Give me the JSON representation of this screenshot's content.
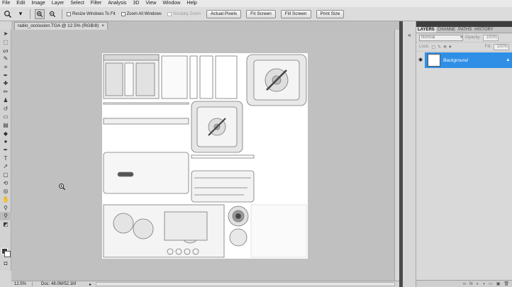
{
  "menubar": {
    "items": [
      "File",
      "Edit",
      "Image",
      "Layer",
      "Select",
      "Filter",
      "Analysis",
      "3D",
      "View",
      "Window",
      "Help"
    ]
  },
  "options": {
    "resize_windows": "Resize Windows To Fit",
    "zoom_all_windows": "Zoom All Windows",
    "scrubby_zoom": "Scrubby Zoom",
    "actual_pixels": "Actual Pixels",
    "fit_screen": "Fit Screen",
    "fill_screen": "Fill Screen",
    "print_size": "Print Size"
  },
  "document": {
    "tab_title": "radio_occlusion.TGA @ 12.5% (RGB/8)",
    "close_glyph": "×"
  },
  "status": {
    "zoom": "12.5%",
    "doc_size": "Doc: 48.0M/52.1M"
  },
  "layers_panel": {
    "tabs": [
      "LAYERS",
      "CHANNE",
      "PATHS",
      "HISTORY"
    ],
    "blend_mode": "Normal",
    "opacity_label": "Opacity:",
    "opacity_value": "100%",
    "lock_label": "Lock:",
    "fill_label": "Fill:",
    "fill_value": "100%",
    "layer_name": "Background"
  },
  "colors": {
    "accent": "#2f8fe6",
    "canvas_bg": "#c0c0c0",
    "ui_bg": "#d6d6d6"
  }
}
